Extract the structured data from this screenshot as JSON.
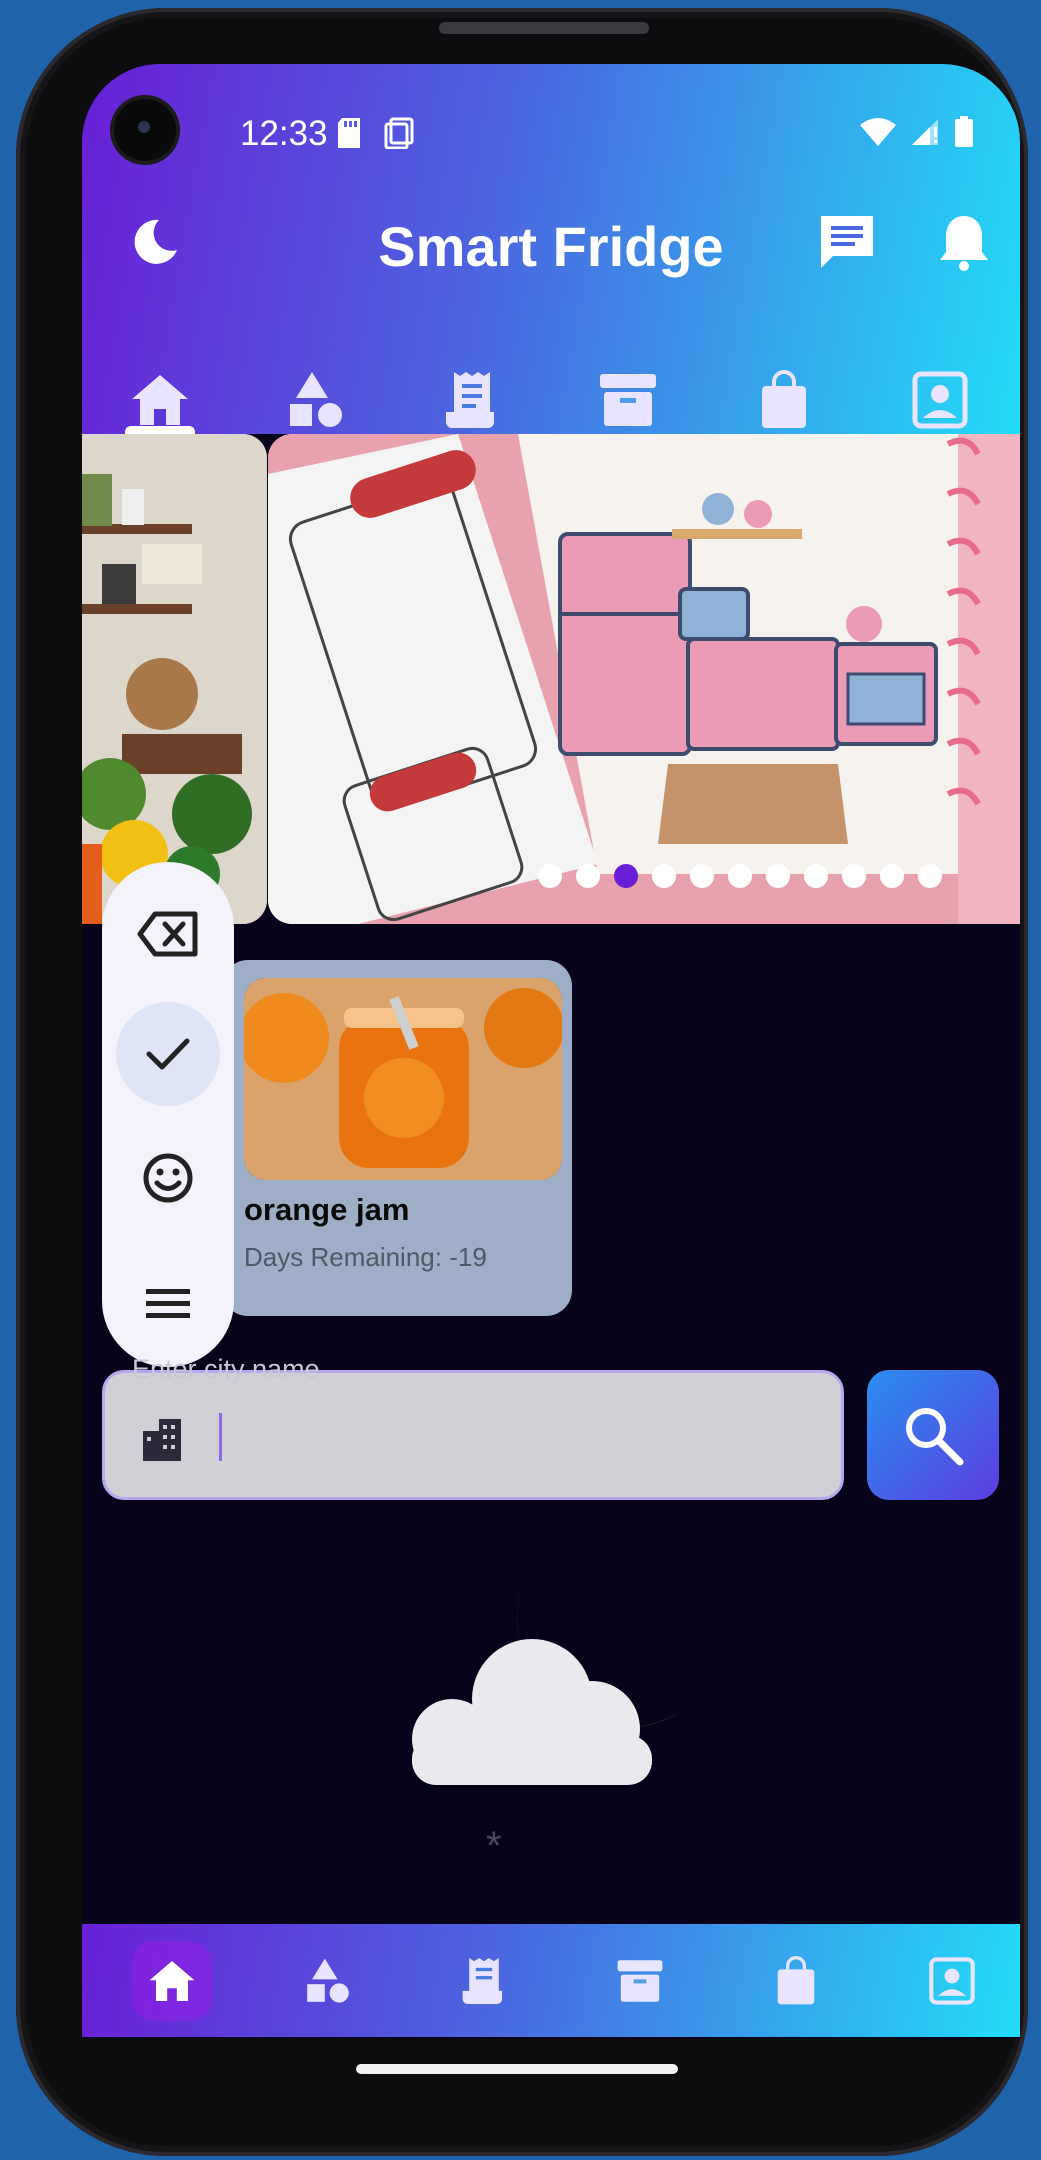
{
  "status_bar": {
    "time": "12:33",
    "icons": [
      "sd-card-icon",
      "screen-icon",
      "wifi-icon",
      "signal-icon",
      "battery-icon"
    ]
  },
  "header": {
    "title": "Smart Fridge",
    "left_icon": "moon-icon",
    "right_icons": [
      "chat-icon",
      "bell-icon"
    ]
  },
  "top_tabs": [
    "home-icon",
    "shapes-icon",
    "receipt-icon",
    "archive-icon",
    "shopping-bag-icon",
    "contact-icon"
  ],
  "carousel": {
    "dot_count": 11,
    "active_index": 2
  },
  "floating_toolbar": [
    "backspace-icon",
    "check-icon",
    "smiley-icon",
    "menu-icon"
  ],
  "item_card": {
    "title": "orange jam",
    "subtitle": "Days Remaining: -19"
  },
  "city_search": {
    "label": "Enter city name",
    "value": ""
  },
  "weather": {
    "icon": "cloud-moon-icon",
    "value": "*"
  },
  "bottom_nav": [
    "home-icon",
    "shapes-icon",
    "receipt-icon",
    "archive-icon",
    "shopping-bag-icon",
    "contact-icon"
  ],
  "colors": {
    "gradient_start": "#6a1fd6",
    "gradient_end": "#22dcf7",
    "screen_bg": "#07031a",
    "card_bg": "#9daec6",
    "active_dot": "#6a1fd6"
  }
}
